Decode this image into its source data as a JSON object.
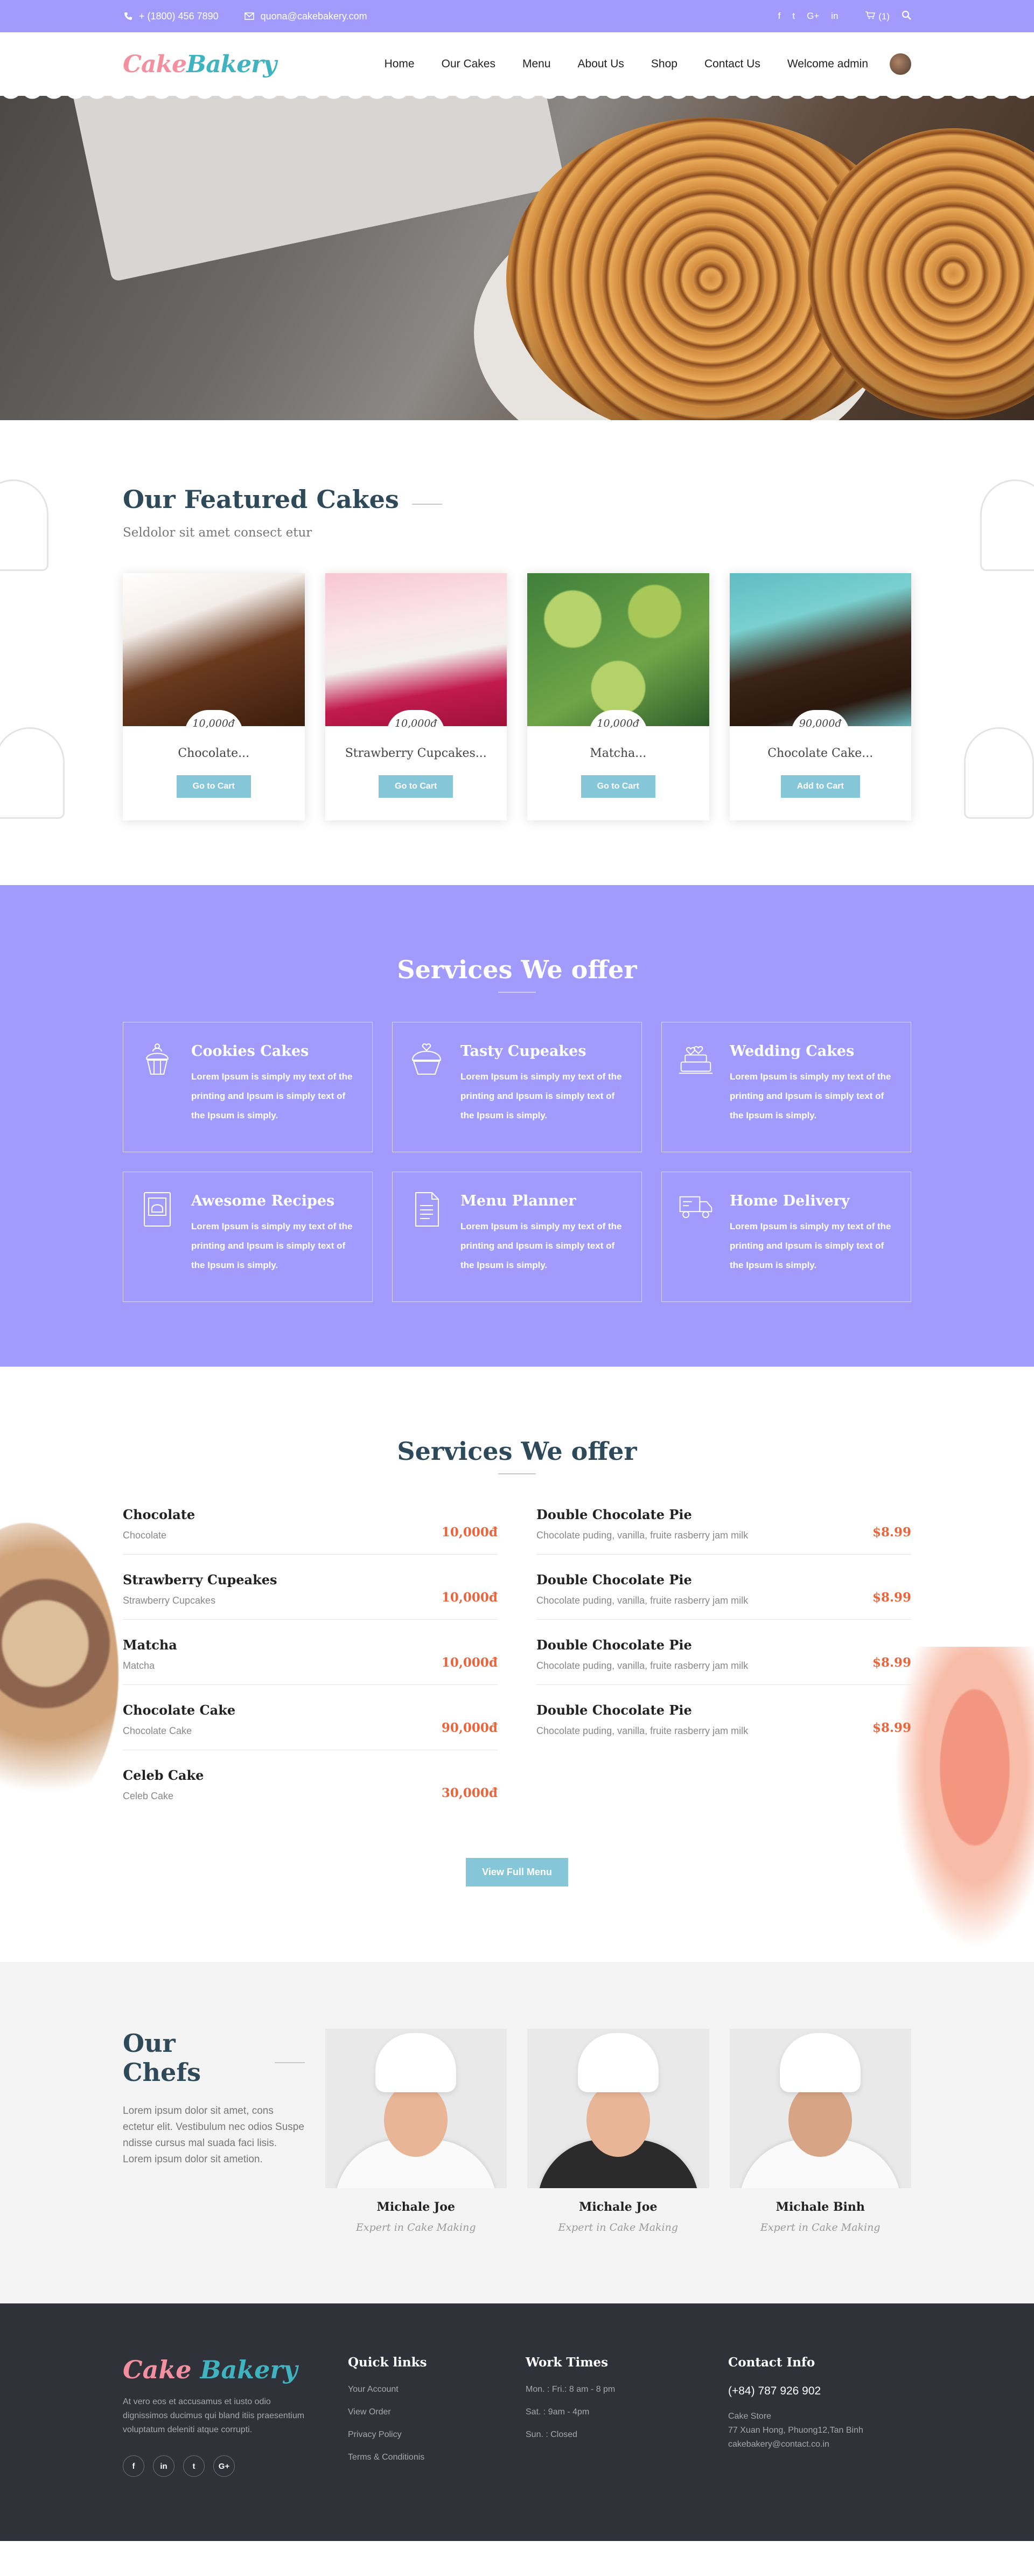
{
  "topbar": {
    "phone": "+ (1800) 456 7890",
    "email": "quona@cakebakery.com",
    "cart": "(1)",
    "social": [
      "f",
      "t",
      "G+",
      "in"
    ]
  },
  "nav": {
    "logo_a": "Cake",
    "logo_b": "Bakery",
    "items": [
      "Home",
      "Our Cakes",
      "Menu",
      "About Us",
      "Shop",
      "Contact Us",
      "Welcome admin"
    ]
  },
  "featured": {
    "title": "Our Featured Cakes",
    "subtitle": "Seldolor sit amet consect etur",
    "cards": [
      {
        "name": "Chocolate...",
        "price": "10,000đ",
        "button": "Go to Cart"
      },
      {
        "name": "Strawberry Cupcakes...",
        "price": "10,000đ",
        "button": "Go to Cart"
      },
      {
        "name": "Matcha...",
        "price": "10,000đ",
        "button": "Go to Cart"
      },
      {
        "name": "Chocolate Cake...",
        "price": "90,000đ",
        "button": "Add to Cart"
      }
    ]
  },
  "services": {
    "title": "Services We offer",
    "items": [
      {
        "icon": "cupcake-icon",
        "title": "Cookies Cakes",
        "text": "Lorem Ipsum is simply my text of the printing and Ipsum is simply text of the Ipsum is simply."
      },
      {
        "icon": "cupcake-heart-icon",
        "title": "Tasty Cupeakes",
        "text": "Lorem Ipsum is simply my text of the printing and Ipsum is simply text of the Ipsum is simply."
      },
      {
        "icon": "wedding-cake-icon",
        "title": "Wedding Cakes",
        "text": "Lorem Ipsum is simply my text of the printing and Ipsum is simply text of the Ipsum is simply."
      },
      {
        "icon": "recipe-book-icon",
        "title": "Awesome Recipes",
        "text": "Lorem Ipsum is simply my text of the printing and Ipsum is simply text of the Ipsum is simply."
      },
      {
        "icon": "menu-planner-icon",
        "title": "Menu Planner",
        "text": "Lorem Ipsum is simply my text of the printing and Ipsum is simply text of the Ipsum is simply."
      },
      {
        "icon": "delivery-truck-icon",
        "title": "Home Delivery",
        "text": "Lorem Ipsum is simply my text of the printing and Ipsum is simply text of the Ipsum is simply."
      }
    ]
  },
  "menu": {
    "title": "Services We offer",
    "left": [
      {
        "name": "Chocolate",
        "desc": "Chocolate",
        "price": "10,000đ"
      },
      {
        "name": "Strawberry Cupeakes",
        "desc": "Strawberry Cupcakes",
        "price": "10,000đ"
      },
      {
        "name": "Matcha",
        "desc": "Matcha",
        "price": "10,000đ"
      },
      {
        "name": "Chocolate Cake",
        "desc": "Chocolate Cake",
        "price": "90,000đ"
      },
      {
        "name": "Celeb Cake",
        "desc": "Celeb Cake",
        "price": "30,000đ"
      }
    ],
    "right": [
      {
        "name": "Double Chocolate Pie",
        "desc": "Chocolate puding, vanilla, fruite rasberry jam milk",
        "price": "$8.99"
      },
      {
        "name": "Double Chocolate Pie",
        "desc": "Chocolate puding, vanilla, fruite rasberry jam milk",
        "price": "$8.99"
      },
      {
        "name": "Double Chocolate Pie",
        "desc": "Chocolate puding, vanilla, fruite rasberry jam milk",
        "price": "$8.99"
      },
      {
        "name": "Double Chocolate Pie",
        "desc": "Chocolate puding, vanilla, fruite rasberry jam milk",
        "price": "$8.99"
      }
    ],
    "button": "View Full Menu"
  },
  "chefs": {
    "title": "Our Chefs",
    "intro": "Lorem ipsum dolor sit amet, cons ectetur elit. Vestibulum nec odios Suspe ndisse cursus mal suada faci lisis. Lorem ipsum dolor sit ametion.",
    "people": [
      {
        "name": "Michale Joe",
        "role": "Expert in Cake Making"
      },
      {
        "name": "Michale Joe",
        "role": "Expert in Cake Making"
      },
      {
        "name": "Michale Binh",
        "role": "Expert in Cake Making"
      }
    ]
  },
  "footer": {
    "logo_a": "Cake",
    "logo_b": "Bakery",
    "about": "At vero eos et accusamus et iusto odio dignissimos ducimus qui bland itiis praesentium voluptatum deleniti atque corrupti.",
    "social": [
      "f",
      "in",
      "t",
      "G+"
    ],
    "quick_title": "Quick links",
    "quick": [
      "Your Account",
      "View Order",
      "Privacy Policy",
      "Terms & Conditionis"
    ],
    "work_title": "Work Times",
    "work": [
      "Mon. : Fri.: 8 am - 8 pm",
      "Sat. : 9am - 4pm",
      "Sun. : Closed"
    ],
    "contact_title": "Contact Info",
    "phone": "(+84) 787 926 902",
    "store": "Cake Store",
    "address": "77 Xuan Hong, Phuong12,Tan Binh",
    "email": "cakebakery@contact.co.in"
  },
  "colors": {
    "purple": "#a29bfe",
    "accent_blue": "#86c6d9",
    "price_orange": "#e8663d",
    "footer_bg": "#2f3239"
  }
}
